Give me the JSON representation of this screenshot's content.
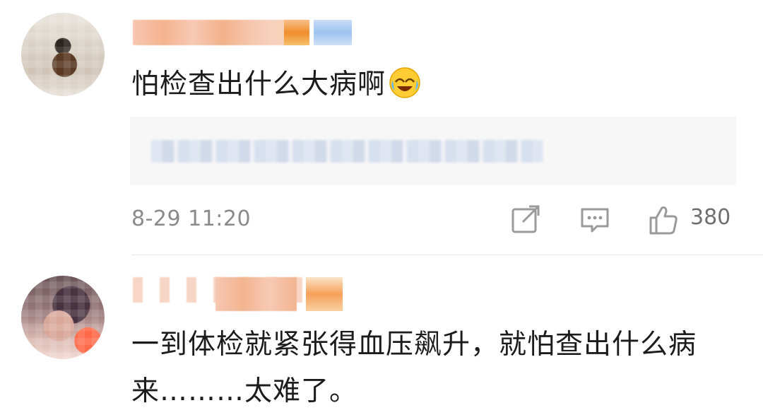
{
  "comments": [
    {
      "text": "怕检查出什么大病啊",
      "emoji": "laughing-crying-emoji",
      "timestamp": "8-29 11:20",
      "likes": "380"
    },
    {
      "text": "一到体检就紧张得血压飙升，就怕查出什么病来………太难了。"
    }
  ],
  "icons": {
    "share": "share-icon",
    "reply": "reply-icon",
    "like": "like-icon"
  },
  "colors": {
    "text": "#1c1c1c",
    "meta": "#8a8a8a",
    "quote_bg": "#f7f7f7",
    "divider": "#e6e6e6"
  }
}
